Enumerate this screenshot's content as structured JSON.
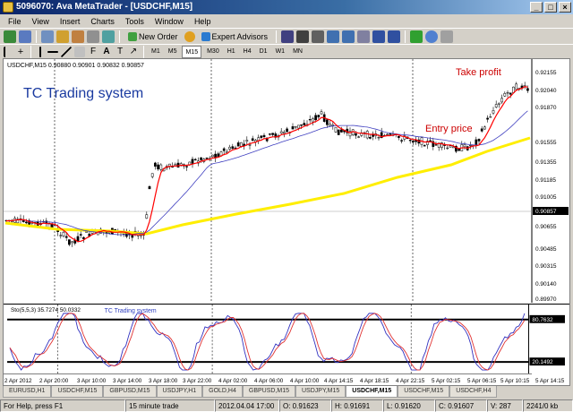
{
  "window": {
    "title": "5096070: Ava MetaTrader - [USDCHF,M15]"
  },
  "menu": [
    "File",
    "View",
    "Insert",
    "Charts",
    "Tools",
    "Window",
    "Help"
  ],
  "toolbar": {
    "new_order": "New Order",
    "expert_advisors": "Expert Advisors",
    "timeframes": [
      "M1",
      "M5",
      "M15",
      "M30",
      "H1",
      "H4",
      "D1",
      "W1",
      "MN"
    ]
  },
  "chart": {
    "symbol_info": "USDCHF,M15  0.90880 0.90901 0.90832 0.90857",
    "watermark": "TC Trading system",
    "annotation_take_profit": "Take profit",
    "annotation_entry_price": "Entry price",
    "price_labels": [
      "0.92155",
      "0.92040",
      "0.91870",
      "0.91555",
      "0.91355",
      "0.91185",
      "0.91005",
      "0.90857",
      "0.90655",
      "0.90485",
      "0.90315",
      "0.90140",
      "0.89970"
    ],
    "current_price": "0.90857",
    "time_labels": [
      "2 Apr 2012",
      "2 Apr 20:00",
      "3 Apr 10:00",
      "3 Apr 14:00",
      "3 Apr 18:00",
      "3 Apr 22:00",
      "4 Apr 02:00",
      "4 Apr 06:00",
      "4 Apr 10:00",
      "4 Apr 14:15",
      "4 Apr 18:15",
      "4 Apr 22:15",
      "5 Apr 02:15",
      "5 Apr 06:15",
      "5 Apr 10:15",
      "5 Apr 14:15"
    ],
    "colors": {
      "candle": "#000000",
      "fast_ma": "#ff0000",
      "slow_ma": "#4040c0",
      "long_ma": "#ffee00",
      "annotation": "#cc0000",
      "watermark": "#1a3aa0"
    }
  },
  "indicator": {
    "label": "Sto(5,5,3) 35.7274 50.0332",
    "watermark": "TC Trading system",
    "levels": [
      "80.7632",
      "20.1492"
    ]
  },
  "tabs": [
    "EURUSD,H1",
    "USDCHF,M15",
    "GBPUSD,M15",
    "USDJPY,H1",
    "GOLD,H4",
    "GBPUSD,M15",
    "USDJPY,M15",
    "USDCHF,M15",
    "USDCHF,M15",
    "USDCHF,H4"
  ],
  "active_tab_index": 7,
  "status": {
    "help": "For Help, press F1",
    "profile": "15 minute trade",
    "datetime": "2012.04.04 17:00",
    "open": "O: 0.91623",
    "high": "H: 0.91691",
    "low": "L: 0.91620",
    "close": "C: 0.91607",
    "volume": "V: 287",
    "traffic": "2241/0 kb"
  }
}
